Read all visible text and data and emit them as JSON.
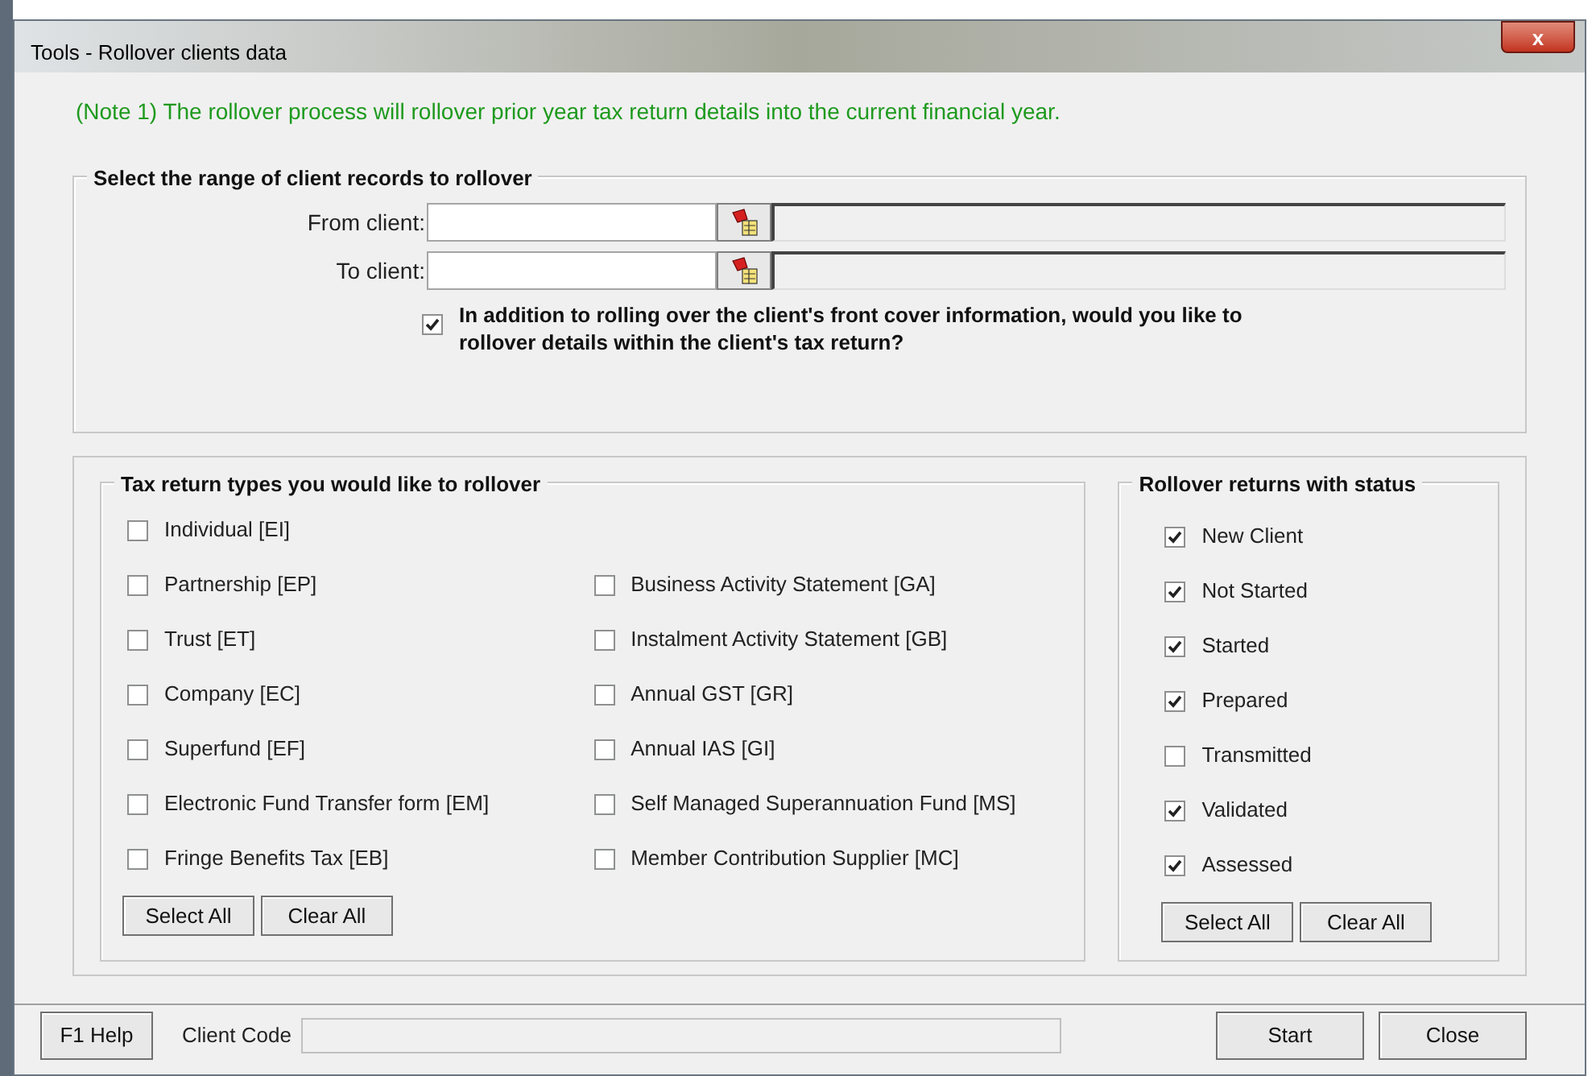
{
  "window": {
    "title": "Tools - Rollover clients data",
    "close": "x"
  },
  "note": "(Note 1) The rollover process will rollover prior year tax return details into the current financial year.",
  "range": {
    "title": "Select the range of client records to rollover",
    "fields": [
      {
        "label": "From client:"
      },
      {
        "label": "To client:"
      }
    ],
    "option": {
      "label": "In addition to rolling over the client's front cover information, would you like to rollover details within the client's tax return?",
      "checked": true
    }
  },
  "tax_types": {
    "title": "Tax return types you would like to rollover",
    "columns": [
      [
        {
          "label": "Individual [EI]",
          "checked": false
        },
        {
          "label": "Partnership [EP]",
          "checked": false
        },
        {
          "label": "Trust [ET]",
          "checked": false
        },
        {
          "label": "Company [EC]",
          "checked": false
        },
        {
          "label": "Superfund [EF]",
          "checked": false
        },
        {
          "label": "Electronic Fund Transfer form [EM]",
          "checked": false
        },
        {
          "label": "Fringe Benefits Tax [EB]",
          "checked": false
        }
      ],
      [
        {
          "label": "Business Activity Statement [GA]",
          "checked": false
        },
        {
          "label": "Instalment Activity Statement [GB]",
          "checked": false
        },
        {
          "label": "Annual GST [GR]",
          "checked": false
        },
        {
          "label": "Annual IAS [GI]",
          "checked": false
        },
        {
          "label": "Self Managed Superannuation Fund [MS]",
          "checked": false
        },
        {
          "label": "Member Contribution Supplier [MC]",
          "checked": false
        }
      ]
    ],
    "buttons": [
      "Select All",
      "Clear All"
    ]
  },
  "statuses": {
    "title": "Rollover returns with status",
    "items": [
      {
        "label": "New Client",
        "checked": true
      },
      {
        "label": "Not Started",
        "checked": true
      },
      {
        "label": "Started",
        "checked": true
      },
      {
        "label": "Prepared",
        "checked": true
      },
      {
        "label": "Transmitted",
        "checked": false
      },
      {
        "label": "Validated",
        "checked": true
      },
      {
        "label": "Assessed",
        "checked": true
      }
    ],
    "buttons": [
      "Select All",
      "Clear All"
    ]
  },
  "footer": {
    "help": "F1 Help",
    "client_code_label": "Client Code",
    "buttons": [
      "Start",
      "Close"
    ]
  }
}
